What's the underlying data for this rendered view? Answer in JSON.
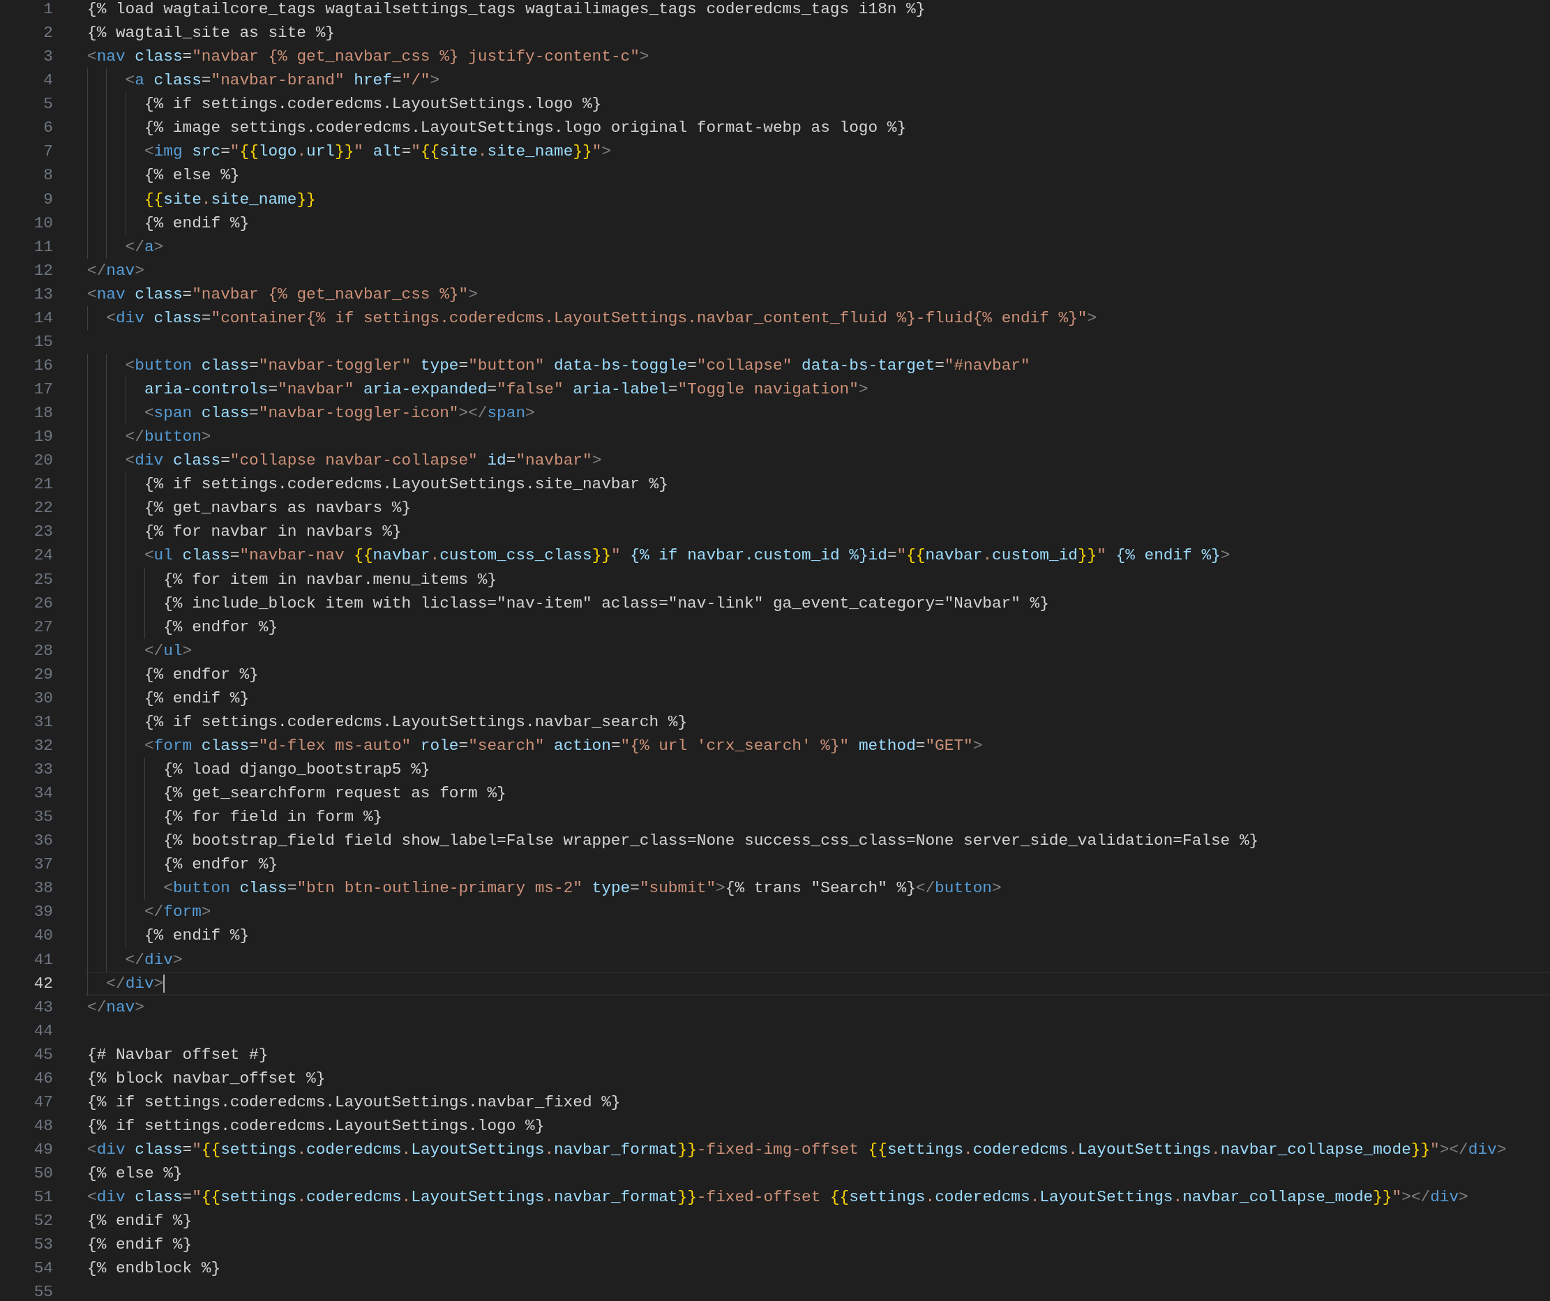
{
  "editor": {
    "lines": [
      {
        "number": "1",
        "text": "{% load wagtailcore_tags wagtailsettings_tags wagtailimages_tags coderedcms_tags i18n %}",
        "current": false
      },
      {
        "number": "2",
        "text": "{% wagtail_site as site %}",
        "current": false
      },
      {
        "number": "3",
        "text": "<nav class=\"navbar {% get_navbar_css %} justify-content-c\">",
        "current": false
      },
      {
        "number": "4",
        "text": "    <a class=\"navbar-brand\" href=\"/\">",
        "current": false
      },
      {
        "number": "5",
        "text": "      {% if settings.coderedcms.LayoutSettings.logo %}",
        "current": false
      },
      {
        "number": "6",
        "text": "      {% image settings.coderedcms.LayoutSettings.logo original format-webp as logo %}",
        "current": false
      },
      {
        "number": "7",
        "text": "      <img src=\"{{logo.url}}\" alt=\"{{site.site_name}}\">",
        "current": false
      },
      {
        "number": "8",
        "text": "      {% else %}",
        "current": false
      },
      {
        "number": "9",
        "text": "      {{site.site_name}}",
        "current": false
      },
      {
        "number": "10",
        "text": "      {% endif %}",
        "current": false
      },
      {
        "number": "11",
        "text": "    </a>",
        "current": false
      },
      {
        "number": "12",
        "text": "</nav>",
        "current": false
      },
      {
        "number": "13",
        "text": "<nav class=\"navbar {% get_navbar_css %}\">",
        "current": false
      },
      {
        "number": "14",
        "text": "  <div class=\"container{% if settings.coderedcms.LayoutSettings.navbar_content_fluid %}-fluid{% endif %}\">",
        "current": false
      },
      {
        "number": "15",
        "current": false
      },
      {
        "number": "16",
        "text": "    <button class=\"navbar-toggler\" type=\"button\" data-bs-toggle=\"collapse\" data-bs-target=\"#navbar\"",
        "current": false
      },
      {
        "number": "17",
        "text": "      aria-controls=\"navbar\" aria-expanded=\"false\" aria-label=\"Toggle navigation\">",
        "current": false
      },
      {
        "number": "18",
        "text": "      <span class=\"navbar-toggler-icon\"></span>",
        "current": false
      },
      {
        "number": "19",
        "text": "    </button>",
        "current": false
      },
      {
        "number": "20",
        "text": "    <div class=\"collapse navbar-collapse\" id=\"navbar\">",
        "current": false
      },
      {
        "number": "21",
        "text": "      {% if settings.coderedcms.LayoutSettings.site_navbar %}",
        "current": false
      },
      {
        "number": "22",
        "text": "      {% get_navbars as navbars %}",
        "current": false
      },
      {
        "number": "23",
        "text": "      {% for navbar in navbars %}",
        "current": false
      },
      {
        "number": "24",
        "text": "      <ul class=\"navbar-nav {{navbar.custom_css_class}}\" {% if navbar.custom_id %}id=\"{{navbar.custom_id}}\" {% endif %}>",
        "current": false
      },
      {
        "number": "25",
        "text": "        {% for item in navbar.menu_items %}",
        "current": false
      },
      {
        "number": "26",
        "text": "        {% include_block item with liclass=\"nav-item\" aclass=\"nav-link\" ga_event_category=\"Navbar\" %}",
        "current": false
      },
      {
        "number": "27",
        "text": "        {% endfor %}",
        "current": false
      },
      {
        "number": "28",
        "text": "      </ul>",
        "current": false
      },
      {
        "number": "29",
        "text": "      {% endfor %}",
        "current": false
      },
      {
        "number": "30",
        "text": "      {% endif %}",
        "current": false
      },
      {
        "number": "31",
        "text": "      {% if settings.coderedcms.LayoutSettings.navbar_search %}",
        "current": false
      },
      {
        "number": "32",
        "text": "      <form class=\"d-flex ms-auto\" role=\"search\" action=\"{% url 'crx_search' %}\" method=\"GET\">",
        "current": false
      },
      {
        "number": "33",
        "text": "        {% load django_bootstrap5 %}",
        "current": false
      },
      {
        "number": "34",
        "text": "        {% get_searchform request as form %}",
        "current": false
      },
      {
        "number": "35",
        "text": "        {% for field in form %}",
        "current": false
      },
      {
        "number": "36",
        "text": "        {% bootstrap_field field show_label=False wrapper_class=None success_css_class=None server_side_validation=False %}",
        "current": false
      },
      {
        "number": "37",
        "text": "        {% endfor %}",
        "current": false
      },
      {
        "number": "38",
        "text": "        <button class=\"btn btn-outline-primary ms-2\" type=\"submit\">{% trans \"Search\" %}</button>",
        "current": false
      },
      {
        "number": "39",
        "text": "      </form>",
        "current": false
      },
      {
        "number": "40",
        "text": "      {% endif %}",
        "current": false
      },
      {
        "number": "41",
        "text": "    </div>",
        "current": false
      },
      {
        "number": "42",
        "text": "  </div>",
        "current": true
      },
      {
        "number": "43",
        "text": "</nav>",
        "current": false
      },
      {
        "number": "44",
        "current": false
      },
      {
        "number": "45",
        "text": "{# Navbar offset #}",
        "current": false
      },
      {
        "number": "46",
        "text": "{% block navbar_offset %}",
        "current": false
      },
      {
        "number": "47",
        "text": "{% if settings.coderedcms.LayoutSettings.navbar_fixed %}",
        "current": false
      },
      {
        "number": "48",
        "text": "{% if settings.coderedcms.LayoutSettings.logo %}",
        "current": false
      },
      {
        "number": "49",
        "text": "<div class=\"{{settings.coderedcms.LayoutSettings.navbar_format}}-fixed-img-offset {{settings.coderedcms.LayoutSettings.navbar_collapse_mode}}\"></div>",
        "current": false
      },
      {
        "number": "50",
        "text": "{% else %}",
        "current": false
      },
      {
        "number": "51",
        "text": "<div class=\"{{settings.coderedcms.LayoutSettings.navbar_format}}-fixed-offset {{settings.coderedcms.LayoutSettings.navbar_collapse_mode}}\"></div>",
        "current": false
      },
      {
        "number": "52",
        "text": "{% endif %}",
        "current": false
      },
      {
        "number": "53",
        "text": "{% endif %}",
        "current": false
      },
      {
        "number": "54",
        "text": "{% endblock %}",
        "current": false
      },
      {
        "number": "55",
        "current": false
      }
    ]
  }
}
